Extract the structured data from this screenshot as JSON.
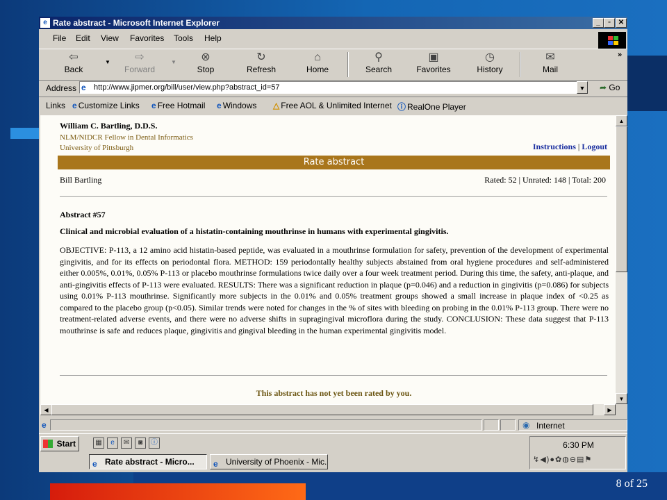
{
  "slide": {
    "page_number": "8 of 25"
  },
  "window": {
    "title": "Rate abstract - Microsoft Internet Explorer"
  },
  "menu": [
    "File",
    "Edit",
    "View",
    "Favorites",
    "Tools",
    "Help"
  ],
  "toolbar": {
    "back": "Back",
    "forward": "Forward",
    "stop": "Stop",
    "refresh": "Refresh",
    "home": "Home",
    "search": "Search",
    "favorites": "Favorites",
    "history": "History",
    "mail": "Mail"
  },
  "address": {
    "label": "Address",
    "url": "http://www.jipmer.org/bill/user/view.php?abstract_id=57",
    "go": "Go"
  },
  "links": {
    "label": "Links",
    "items": [
      "Customize Links",
      "Free Hotmail",
      "Windows",
      "Free AOL & Unlimited Internet",
      "RealOne Player"
    ]
  },
  "page": {
    "author_name": "William C. Bartling, D.D.S.",
    "author_title": "NLM/NIDCR Fellow in Dental Informatics",
    "author_affiliation": "University of Pittsburgh",
    "nav_instructions": "Instructions",
    "nav_separator": "|",
    "nav_logout": "Logout",
    "header": "Rate abstract",
    "user": "Bill Bartling",
    "stats": "Rated: 52 | Unrated: 148 | Total: 200",
    "abstract_number": "Abstract #57",
    "abstract_title": "Clinical and microbial evaluation of a histatin-containing mouthrinse in humans with experimental gingivitis.",
    "abstract_body": "OBJECTIVE: P-113, a 12 amino acid histatin-based peptide, was evaluated in a mouthrinse formulation for safety, prevention of the development of experimental gingivitis, and for its effects on periodontal flora. METHOD: 159 periodontally healthy subjects abstained from oral hygiene procedures and self-administered either 0.005%, 0.01%, 0.05% P-113 or placebo mouthrinse formulations twice daily over a four week treatment period. During this time, the safety, anti-plaque, and anti-gingivitis effects of P-113 were evaluated. RESULTS: There was a significant reduction in plaque (p=0.046) and a reduction in gingivitis (p=0.086) for subjects using 0.01% P-113 mouthrinse. Significantly more subjects in the 0.01% and 0.05% treatment groups showed a small increase in plaque index of <0.25 as compared to the placebo group (p<0.05). Similar trends were noted for changes in the % of sites with bleeding on probing in the 0.01% P-113 group. There were no treatment-related adverse events, and there were no adverse shifts in supragingival microflora during the study. CONCLUSION: These data suggest that P-113 mouthrinse is safe and reduces plaque, gingivitis and gingival bleeding in the human experimental gingivitis model.",
    "not_rated": "This abstract has not yet been rated by you."
  },
  "status": {
    "zone": "Internet"
  },
  "taskbar": {
    "start": "Start",
    "clock": "6:30 PM",
    "tasks": [
      "Rate abstract - Micro...",
      "University of Phoenix - Mic..."
    ]
  }
}
